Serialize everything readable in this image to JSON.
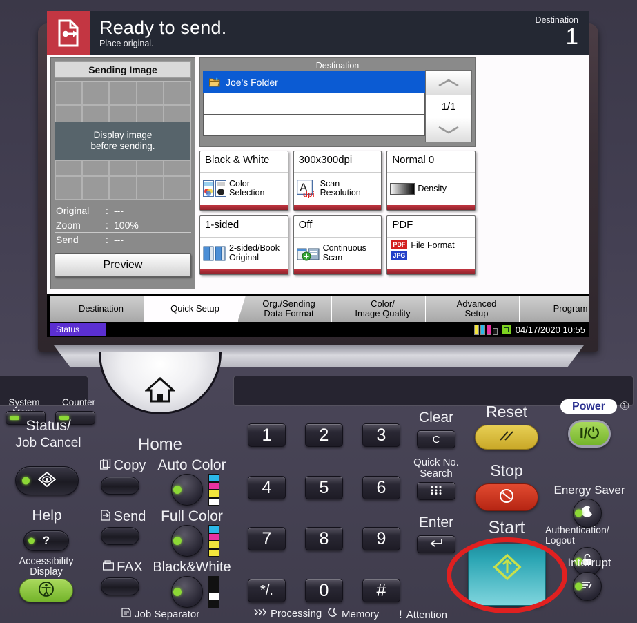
{
  "header": {
    "title": "Ready to send.",
    "subtitle": "Place original.",
    "status_icon": "send-document-icon",
    "destination_label": "Destination",
    "destination_count": "1"
  },
  "preview": {
    "title": "Sending Image",
    "placeholder_line1": "Display image",
    "placeholder_line2": "before sending.",
    "info": [
      {
        "key": "Original",
        "colon": ":",
        "value": "---"
      },
      {
        "key": "Zoom",
        "colon": ":",
        "value": "100%"
      },
      {
        "key": "Send",
        "colon": ":",
        "value": "---"
      }
    ],
    "preview_button": "Preview"
  },
  "destination": {
    "panel_label": "Destination",
    "items": [
      {
        "label": "Joe's Folder",
        "icon": "folder-icon",
        "selected": true
      },
      {
        "label": "",
        "icon": "",
        "selected": false
      },
      {
        "label": "",
        "icon": "",
        "selected": false
      }
    ],
    "page_indicator": "1/1",
    "scroll_up_icon": "chevron-up-icon",
    "scroll_down_icon": "chevron-down-icon"
  },
  "functions": [
    {
      "value": "Black & White",
      "name": "Color\nSelection",
      "name_l1": "Color",
      "name_l2": "Selection",
      "icon": "color-selection-icon"
    },
    {
      "value": "300x300dpi",
      "name_l1": "Scan",
      "name_l2": "Resolution",
      "icon": "scan-resolution-icon"
    },
    {
      "value": "Normal 0",
      "name_l1": "Density",
      "name_l2": "",
      "icon": "density-icon"
    },
    {
      "value": "1-sided",
      "name_l1": "2-sided/Book",
      "name_l2": "Original",
      "icon": "duplex-original-icon"
    },
    {
      "value": "Off",
      "name_l1": "Continuous",
      "name_l2": "Scan",
      "icon": "continuous-scan-icon"
    },
    {
      "value": "PDF",
      "name_l1": "File Format",
      "name_l2": "",
      "icon": "file-format-icon",
      "badge1": "PDF",
      "badge2": "JPG"
    }
  ],
  "tabs": [
    {
      "label_l1": "Destination",
      "label_l2": "",
      "active": false
    },
    {
      "label_l1": "Quick Setup",
      "label_l2": "",
      "active": true
    },
    {
      "label_l1": "Org./Sending",
      "label_l2": "Data Format",
      "active": false
    },
    {
      "label_l1": "Color/",
      "label_l2": "Image Quality",
      "active": false
    },
    {
      "label_l1": "Advanced",
      "label_l2": "Setup",
      "active": false
    },
    {
      "label_l1": "Program",
      "label_l2": "",
      "active": false
    }
  ],
  "statusbar": {
    "status_label": "Status",
    "datetime": "04/17/2020 10:55",
    "toner_colors": [
      "#f2e53c",
      "#2bb8e8",
      "#e832a0",
      "#1a1a1a"
    ],
    "memory_icon": "memory-card-icon"
  },
  "control_panel": {
    "system_menu_label": "System Menu",
    "counter_label": "Counter",
    "status_job_cancel_l1": "Status/",
    "status_job_cancel_l2": "Job Cancel",
    "status_icon": "status-job-cancel-icon",
    "help_label": "Help",
    "help_icon": "question-mark-icon",
    "accessibility_l1": "Accessibility",
    "accessibility_l2": "Display",
    "accessibility_icon": "accessibility-icon",
    "home_label": "Home",
    "home_icon": "home-icon",
    "copy_label": "Copy",
    "copy_icon": "copy-icon",
    "send_label": "Send",
    "send_icon": "send-icon",
    "fax_label": "FAX",
    "fax_icon": "fax-icon",
    "auto_color_label": "Auto Color",
    "full_color_label": "Full Color",
    "black_white_label": "Black&White",
    "job_separator_label": "Job Separator",
    "job_separator_icon": "job-separator-icon",
    "keypad": [
      "1",
      "2",
      "3",
      "4",
      "5",
      "6",
      "7",
      "8",
      "9",
      "*/.",
      "0",
      "#"
    ],
    "clear_label": "Clear",
    "clear_key": "C",
    "quick_no_l1": "Quick No.",
    "quick_no_l2": "Search",
    "quick_no_icon": "keypad-dots-icon",
    "enter_label": "Enter",
    "enter_icon": "enter-arrow-icon",
    "reset_label": "Reset",
    "reset_icon": "reset-slashes-icon",
    "stop_label": "Stop",
    "stop_icon": "stop-circle-icon",
    "start_label": "Start",
    "start_icon": "start-diamond-icon",
    "power_label": "Power",
    "power_icon": "power-onoff-icon",
    "energy_saver_label": "Energy Saver",
    "energy_saver_icon": "moon-icon",
    "auth_logout_l1": "Authentication/",
    "auth_logout_l2": "Logout",
    "auth_logout_icon": "lock-icon",
    "interrupt_label": "Interrupt",
    "interrupt_icon": "interrupt-icon",
    "processing_label": "Processing",
    "processing_icon": "processing-chevrons-icon",
    "memory_label": "Memory",
    "memory_icon": "memory-moon-icon",
    "attention_label": "Attention",
    "attention_icon": "exclamation-icon"
  },
  "colors": {
    "accent_red": "#c33642",
    "selection_blue": "#0b5bd3",
    "status_purple": "#5b2fd1",
    "annotation_red": "#e02020",
    "start_teal": "#2ca6b4"
  }
}
